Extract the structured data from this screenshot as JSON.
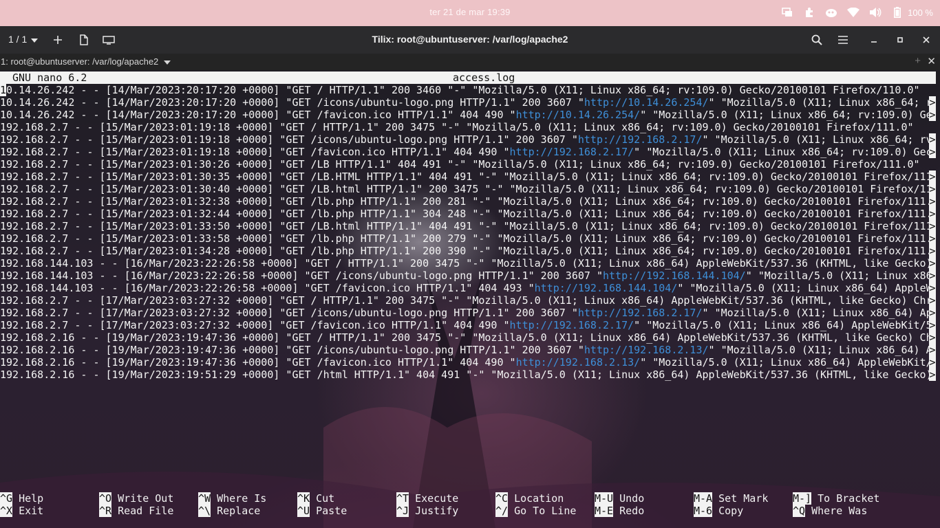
{
  "topbar": {
    "clock": "ter 21 de mar  19:39",
    "battery": "100 %",
    "icons": [
      "screen-share-icon",
      "extension-icon",
      "system-monitor-icon",
      "wifi-icon",
      "volume-icon",
      "battery-icon"
    ]
  },
  "header": {
    "session": "1 / 1",
    "title": "Tilix: root@ubuntuserver: /var/log/apache2"
  },
  "terminal_bar": {
    "title": "1: root@ubuntuserver: /var/log/apache2"
  },
  "nano": {
    "version": "GNU nano 6.2",
    "filename": "access.log",
    "more_marker": ">",
    "lines": [
      {
        "segments": [
          {
            "t": "10.14.26.242 - - [14/Mar/2023:20:17:20 +0000] \"GET / HTTP/1.1\" 200 3460 \"-\" \"Mozilla/5.0 (X11; Linux x86_64; rv:109.0) Gecko/20100101 Firefox/110.0\""
          }
        ],
        "more": false
      },
      {
        "segments": [
          {
            "t": "10.14.26.242 - - [14/Mar/2023:20:17:20 +0000] \"GET /icons/ubuntu-logo.png HTTP/1.1\" 200 3607 \""
          },
          {
            "t": "http://10.14.26.254/",
            "url": true
          },
          {
            "t": "\" \"Mozilla/5.0 (X11; Linux x86_64; r"
          }
        ],
        "more": true
      },
      {
        "segments": [
          {
            "t": "10.14.26.242 - - [14/Mar/2023:20:17:20 +0000] \"GET /favicon.ico HTTP/1.1\" 404 490 \""
          },
          {
            "t": "http://10.14.26.254/",
            "url": true
          },
          {
            "t": "\" \"Mozilla/5.0 (X11; Linux x86_64; rv:109.0) Ge"
          }
        ],
        "more": true
      },
      {
        "segments": [
          {
            "t": "192.168.2.7 - - [15/Mar/2023:01:19:18 +0000] \"GET / HTTP/1.1\" 200 3475 \"-\" \"Mozilla/5.0 (X11; Linux x86_64; rv:109.0) Gecko/20100101 Firefox/111.0\""
          }
        ],
        "more": false
      },
      {
        "segments": [
          {
            "t": "192.168.2.7 - - [15/Mar/2023:01:19:18 +0000] \"GET /icons/ubuntu-logo.png HTTP/1.1\" 200 3607 \""
          },
          {
            "t": "http://192.168.2.17/",
            "url": true
          },
          {
            "t": "\" \"Mozilla/5.0 (X11; Linux x86_64; rv"
          }
        ],
        "more": true
      },
      {
        "segments": [
          {
            "t": "192.168.2.7 - - [15/Mar/2023:01:19:18 +0000] \"GET /favicon.ico HTTP/1.1\" 404 490 \""
          },
          {
            "t": "http://192.168.2.17/",
            "url": true
          },
          {
            "t": "\" \"Mozilla/5.0 (X11; Linux x86_64; rv:109.0) Gec"
          }
        ],
        "more": true
      },
      {
        "segments": [
          {
            "t": "192.168.2.7 - - [15/Mar/2023:01:30:26 +0000] \"GET /LB HTTP/1.1\" 404 491 \"-\" \"Mozilla/5.0 (X11; Linux x86_64; rv:109.0) Gecko/20100101 Firefox/111.0\""
          }
        ],
        "more": false
      },
      {
        "segments": [
          {
            "t": "192.168.2.7 - - [15/Mar/2023:01:30:35 +0000] \"GET /LB.HTML HTTP/1.1\" 404 491 \"-\" \"Mozilla/5.0 (X11; Linux x86_64; rv:109.0) Gecko/20100101 Firefox/111"
          }
        ],
        "more": true
      },
      {
        "segments": [
          {
            "t": "192.168.2.7 - - [15/Mar/2023:01:30:40 +0000] \"GET /LB.html HTTP/1.1\" 200 3475 \"-\" \"Mozilla/5.0 (X11; Linux x86_64; rv:109.0) Gecko/20100101 Firefox/11"
          }
        ],
        "more": true
      },
      {
        "segments": [
          {
            "t": "192.168.2.7 - - [15/Mar/2023:01:32:38 +0000] \"GET /lb.php HTTP/1.1\" 200 281 \"-\" \"Mozilla/5.0 (X11; Linux x86_64; rv:109.0) Gecko/20100101 Firefox/111."
          }
        ],
        "more": true
      },
      {
        "segments": [
          {
            "t": "192.168.2.7 - - [15/Mar/2023:01:32:44 +0000] \"GET /lb.php HTTP/1.1\" 304 248 \"-\" \"Mozilla/5.0 (X11; Linux x86_64; rv:109.0) Gecko/20100101 Firefox/111."
          }
        ],
        "more": true
      },
      {
        "segments": [
          {
            "t": "192.168.2.7 - - [15/Mar/2023:01:33:50 +0000] \"GET /LB.html HTTP/1.1\" 404 491 \"-\" \"Mozilla/5.0 (X11; Linux x86_64; rv:109.0) Gecko/20100101 Firefox/111"
          }
        ],
        "more": true
      },
      {
        "segments": [
          {
            "t": "192.168.2.7 - - [15/Mar/2023:01:33:58 +0000] \"GET /lb.php HTTP/1.1\" 200 279 \"-\" \"Mozilla/5.0 (X11; Linux x86_64; rv:109.0) Gecko/20100101 Firefox/111."
          }
        ],
        "more": true
      },
      {
        "segments": [
          {
            "t": "192.168.2.7 - - [15/Mar/2023:01:34:28 +0000] \"GET /lb.php HTTP/1.1\" 200 390 \"-\" \"Mozilla/5.0 (X11; Linux x86_64; rv:109.0) Gecko/20100101 Firefox/111."
          }
        ],
        "more": true
      },
      {
        "segments": [
          {
            "t": "192.168.144.103 - - [16/Mar/2023:22:26:58 +0000] \"GET / HTTP/1.1\" 200 3475 \"-\" \"Mozilla/5.0 (X11; Linux x86_64) AppleWebKit/537.36 (KHTML, like Gecko)"
          }
        ],
        "more": true
      },
      {
        "segments": [
          {
            "t": "192.168.144.103 - - [16/Mar/2023:22:26:58 +0000] \"GET /icons/ubuntu-logo.png HTTP/1.1\" 200 3607 \""
          },
          {
            "t": "http://192.168.144.104/",
            "url": true
          },
          {
            "t": "\" \"Mozilla/5.0 (X11; Linux x86"
          }
        ],
        "more": true
      },
      {
        "segments": [
          {
            "t": "192.168.144.103 - - [16/Mar/2023:22:26:58 +0000] \"GET /favicon.ico HTTP/1.1\" 404 493 \""
          },
          {
            "t": "http://192.168.144.104/",
            "url": true
          },
          {
            "t": "\" \"Mozilla/5.0 (X11; Linux x86_64) AppleW"
          }
        ],
        "more": true
      },
      {
        "segments": [
          {
            "t": "192.168.2.7 - - [17/Mar/2023:03:27:32 +0000] \"GET / HTTP/1.1\" 200 3475 \"-\" \"Mozilla/5.0 (X11; Linux x86_64) AppleWebKit/537.36 (KHTML, like Gecko) Chr"
          }
        ],
        "more": true
      },
      {
        "segments": [
          {
            "t": "192.168.2.7 - - [17/Mar/2023:03:27:32 +0000] \"GET /icons/ubuntu-logo.png HTTP/1.1\" 200 3607 \""
          },
          {
            "t": "http://192.168.2.17/",
            "url": true
          },
          {
            "t": "\" \"Mozilla/5.0 (X11; Linux x86_64) Ap"
          }
        ],
        "more": true
      },
      {
        "segments": [
          {
            "t": "192.168.2.7 - - [17/Mar/2023:03:27:32 +0000] \"GET /favicon.ico HTTP/1.1\" 404 490 \""
          },
          {
            "t": "http://192.168.2.17/",
            "url": true
          },
          {
            "t": "\" \"Mozilla/5.0 (X11; Linux x86_64) AppleWebKit/5"
          }
        ],
        "more": true
      },
      {
        "segments": [
          {
            "t": "192.168.2.16 - - [19/Mar/2023:19:47:36 +0000] \"GET / HTTP/1.1\" 200 3475 \"-\" \"Mozilla/5.0 (X11; Linux x86_64) AppleWebKit/537.36 (KHTML, like Gecko) Ch"
          }
        ],
        "more": true
      },
      {
        "segments": [
          {
            "t": "192.168.2.16 - - [19/Mar/2023:19:47:36 +0000] \"GET /icons/ubuntu-logo.png HTTP/1.1\" 200 3607 \""
          },
          {
            "t": "http://192.168.2.13/",
            "url": true
          },
          {
            "t": "\" \"Mozilla/5.0 (X11; Linux x86_64) A"
          }
        ],
        "more": true
      },
      {
        "segments": [
          {
            "t": "192.168.2.16 - - [19/Mar/2023:19:47:36 +0000] \"GET /favicon.ico HTTP/1.1\" 404 490 \""
          },
          {
            "t": "http://192.168.2.13/",
            "url": true
          },
          {
            "t": "\" \"Mozilla/5.0 (X11; Linux x86_64) AppleWebKit/"
          }
        ],
        "more": true
      },
      {
        "segments": [
          {
            "t": "192.168.2.16 - - [19/Mar/2023:19:51:29 +0000] \"GET /html HTTP/1.1\" 404 491 \"-\" \"Mozilla/5.0 (X11; Linux x86_64) AppleWebKit/537.36 (KHTML, like Gecko)"
          }
        ],
        "more": true
      }
    ],
    "shortcuts": [
      {
        "key": "^G",
        "label": "Help",
        "col": 0,
        "row": 0
      },
      {
        "key": "^X",
        "label": "Exit",
        "col": 0,
        "row": 1
      },
      {
        "key": "^O",
        "label": "Write Out",
        "col": 1,
        "row": 0
      },
      {
        "key": "^R",
        "label": "Read File",
        "col": 1,
        "row": 1
      },
      {
        "key": "^W",
        "label": "Where Is",
        "col": 2,
        "row": 0
      },
      {
        "key": "^\\",
        "label": "Replace",
        "col": 2,
        "row": 1
      },
      {
        "key": "^K",
        "label": "Cut",
        "col": 3,
        "row": 0
      },
      {
        "key": "^U",
        "label": "Paste",
        "col": 3,
        "row": 1
      },
      {
        "key": "^T",
        "label": "Execute",
        "col": 4,
        "row": 0
      },
      {
        "key": "^J",
        "label": "Justify",
        "col": 4,
        "row": 1
      },
      {
        "key": "^C",
        "label": "Location",
        "col": 5,
        "row": 0
      },
      {
        "key": "^/",
        "label": "Go To Line",
        "col": 5,
        "row": 1
      },
      {
        "key": "M-U",
        "label": "Undo",
        "col": 6,
        "row": 0
      },
      {
        "key": "M-E",
        "label": "Redo",
        "col": 6,
        "row": 1
      },
      {
        "key": "M-A",
        "label": "Set Mark",
        "col": 7,
        "row": 0
      },
      {
        "key": "M-6",
        "label": "Copy",
        "col": 7,
        "row": 1
      },
      {
        "key": "M-]",
        "label": "To Bracket",
        "col": 8,
        "row": 0
      },
      {
        "key": "^Q",
        "label": "Where Was",
        "col": 8,
        "row": 1
      }
    ]
  },
  "colors": {
    "topbar": "#edc3c7",
    "headerbar": "#2b2b2d",
    "url": "#3e8fd8",
    "text": "#f4f4f4"
  }
}
